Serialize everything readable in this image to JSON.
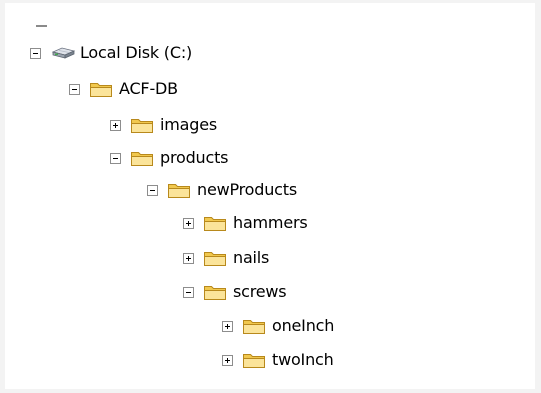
{
  "colors": {
    "background": "#ffffff",
    "folder_body": "#f1c84e",
    "folder_front": "#fbe49a",
    "folder_outline": "#b8891c",
    "expander_border": "#8d8d8d"
  },
  "tree": {
    "root": {
      "label": "Local Disk (C:)",
      "icon": "hard-drive-icon",
      "expander": "collapse"
    },
    "acf_db": {
      "label": "ACF-DB",
      "icon": "folder-icon",
      "expander": "collapse"
    },
    "images": {
      "label": "images",
      "icon": "folder-icon",
      "expander": "expand"
    },
    "products": {
      "label": "products",
      "icon": "folder-icon",
      "expander": "collapse"
    },
    "new_products": {
      "label": "newProducts",
      "icon": "folder-icon",
      "expander": "collapse"
    },
    "hammers": {
      "label": "hammers",
      "icon": "folder-icon",
      "expander": "expand"
    },
    "nails": {
      "label": "nails",
      "icon": "folder-icon",
      "expander": "expand"
    },
    "screws": {
      "label": "screws",
      "icon": "folder-icon",
      "expander": "collapse"
    },
    "one_inch": {
      "label": "oneInch",
      "icon": "folder-icon",
      "expander": "expand"
    },
    "two_inch": {
      "label": "twoInch",
      "icon": "folder-icon",
      "expander": "expand"
    }
  }
}
